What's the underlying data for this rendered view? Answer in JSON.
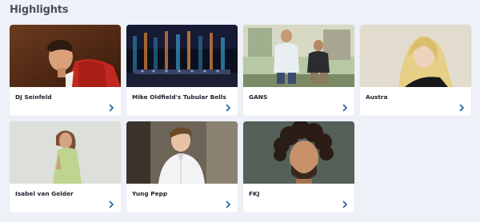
{
  "section": {
    "title": "Highlights"
  },
  "cards": [
    {
      "title": "DJ Seinfeld",
      "thumbnail": "portrait-red-jacket"
    },
    {
      "title": "Mike Oldfield's Tubular Bells",
      "thumbnail": "concert-stage"
    },
    {
      "title": "GANS",
      "thumbnail": "duo-outdoor-photo"
    },
    {
      "title": "Austra",
      "thumbnail": "portrait-blonde-hair"
    },
    {
      "title": "Isabel van Gelder",
      "thumbnail": "portrait-green-dress"
    },
    {
      "title": "Yung Pepp",
      "thumbnail": "portrait-white-jacket"
    },
    {
      "title": "FKJ",
      "thumbnail": "portrait-curly-hair"
    }
  ],
  "colors": {
    "accent": "#1f5fa8",
    "background": "#eef1f7",
    "card": "#ffffff"
  },
  "icons": {
    "card_link": "chevron-right-icon"
  }
}
